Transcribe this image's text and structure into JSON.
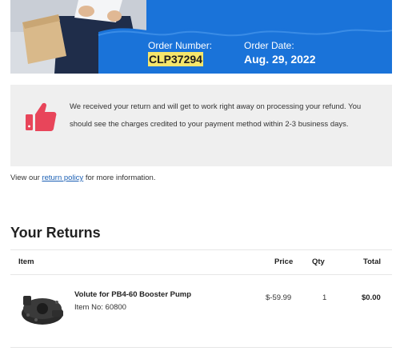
{
  "banner": {
    "order_number_label": "Order Number:",
    "order_number_value": "CLP37294",
    "order_date_label": "Order Date:",
    "order_date_value": "Aug. 29, 2022"
  },
  "notice": {
    "icon": "thumbs-up-icon",
    "text": "We received your return and will get to work right away on processing your refund. You should see the charges credited to your payment method within 2-3 business days."
  },
  "policy": {
    "prefix": "View our ",
    "link": "return policy",
    "suffix": " for more information."
  },
  "returns": {
    "title": "Your Returns",
    "columns": {
      "item": "Item",
      "price": "Price",
      "qty": "Qty",
      "total": "Total"
    },
    "items": [
      {
        "name": "Volute for PB4-60 Booster Pump",
        "item_no": "Item No: 60800",
        "price": "$-59.99",
        "qty": "1",
        "total": "$0.00"
      }
    ]
  },
  "colors": {
    "banner_blue": "#1a73d9",
    "highlight": "#f6e66b",
    "thumb": "#e8455a",
    "link": "#1a5fb4"
  }
}
